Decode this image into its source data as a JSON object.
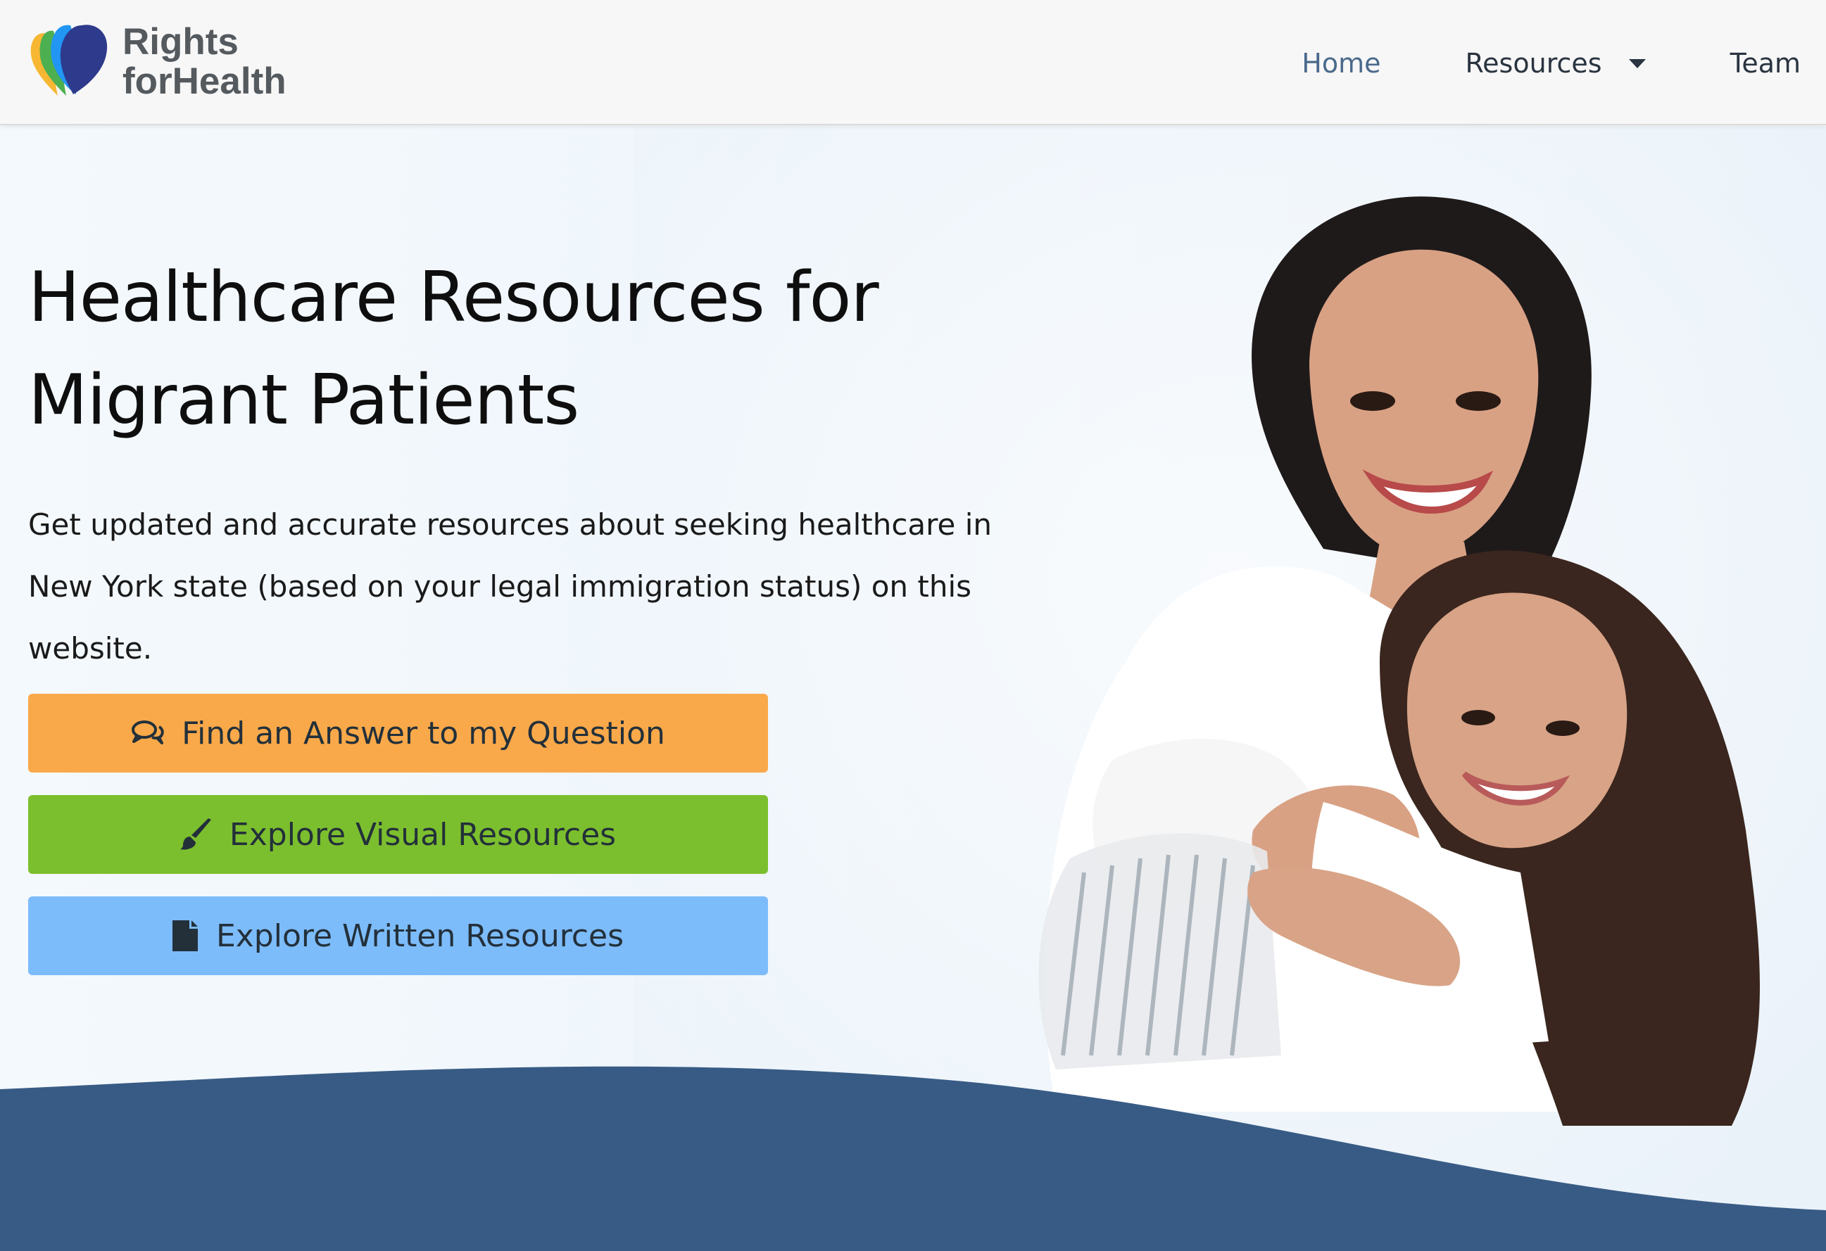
{
  "brand": {
    "line1": "Rights",
    "line2": "forHealth",
    "logo_icon": "heart-logo-icon",
    "colors": [
      "#f7b733",
      "#4caf50",
      "#2196f3",
      "#2e3a8c"
    ]
  },
  "nav": {
    "home": "Home",
    "resources": "Resources",
    "team": "Team"
  },
  "hero": {
    "title_line1": "Healthcare Resources for",
    "title_line2": "Migrant Patients",
    "subtitle": "Get updated and accurate resources about seeking healthcare in New York state (based on your legal immigration status) on this website."
  },
  "buttons": {
    "answer": {
      "label": "Find an Answer to my Question",
      "icon": "comments-icon",
      "color": "#f9a94a"
    },
    "visual": {
      "label": "Explore Visual Resources",
      "icon": "paintbrush-icon",
      "color": "#7cbf2e"
    },
    "written": {
      "label": "Explore Written Resources",
      "icon": "document-icon",
      "color": "#7dbcfb"
    }
  },
  "footer_wave_color": "#385b85"
}
